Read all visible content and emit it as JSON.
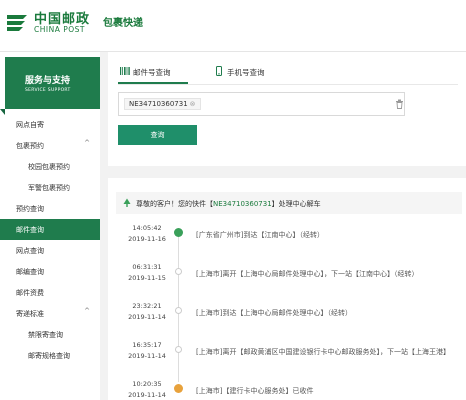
{
  "header": {
    "logo_cn": "中国邮政",
    "logo_en": "CHINA POST",
    "logo_sub": "包裹快递"
  },
  "sidebar": {
    "banner_title": "服务与支持",
    "banner_sub": "SERVICE SUPPORT",
    "items": [
      {
        "label": "网点自寄",
        "indent": false,
        "chevron": ""
      },
      {
        "label": "包裹预约",
        "indent": false,
        "chevron": "^"
      },
      {
        "label": "校园包裹预约",
        "indent": true,
        "chevron": ""
      },
      {
        "label": "军警包裹预约",
        "indent": true,
        "chevron": ""
      },
      {
        "label": "预约查询",
        "indent": false,
        "chevron": ""
      },
      {
        "label": "邮件查询",
        "indent": false,
        "chevron": "",
        "active": true
      },
      {
        "label": "网点查询",
        "indent": false,
        "chevron": ""
      },
      {
        "label": "邮编查询",
        "indent": false,
        "chevron": ""
      },
      {
        "label": "邮件资费",
        "indent": false,
        "chevron": ""
      },
      {
        "label": "寄递标准",
        "indent": false,
        "chevron": "^"
      },
      {
        "label": "禁限寄查询",
        "indent": true,
        "chevron": ""
      },
      {
        "label": "邮寄规格查询",
        "indent": true,
        "chevron": ""
      }
    ]
  },
  "tabs": {
    "waybill": "邮件号查询",
    "phone": "手机号查询"
  },
  "query": {
    "tag": "NE34710360731",
    "tag_close": "⊗",
    "button": "查询"
  },
  "result": {
    "prefix": "尊敬的客户！您的快件【",
    "number": "NE34710360731",
    "suffix": "】处理中心解车"
  },
  "timeline": [
    {
      "time": "14:05:42",
      "date": "2019-11-16",
      "text": "[广东省广州市]到达【江南中心】（经转）",
      "dot": "green"
    },
    {
      "time": "06:31:31",
      "date": "2019-11-15",
      "text": "[上海市]离开【上海中心局邮件处理中心】，下一站【江南中心】（经转）",
      "dot": "grey"
    },
    {
      "time": "23:32:21",
      "date": "2019-11-14",
      "text": "[上海市]到达【上海中心局邮件处理中心】（经转）",
      "dot": "grey"
    },
    {
      "time": "16:35:17",
      "date": "2019-11-14",
      "text": "[上海市]离开【邮政黄浦区中国建设银行卡中心邮政服务处】，下一站【上海王港】",
      "dot": "grey"
    },
    {
      "time": "10:20:35",
      "date": "2019-11-14",
      "text": "[上海市]【建行卡中心服务处】已收件",
      "dot": "orange"
    }
  ]
}
